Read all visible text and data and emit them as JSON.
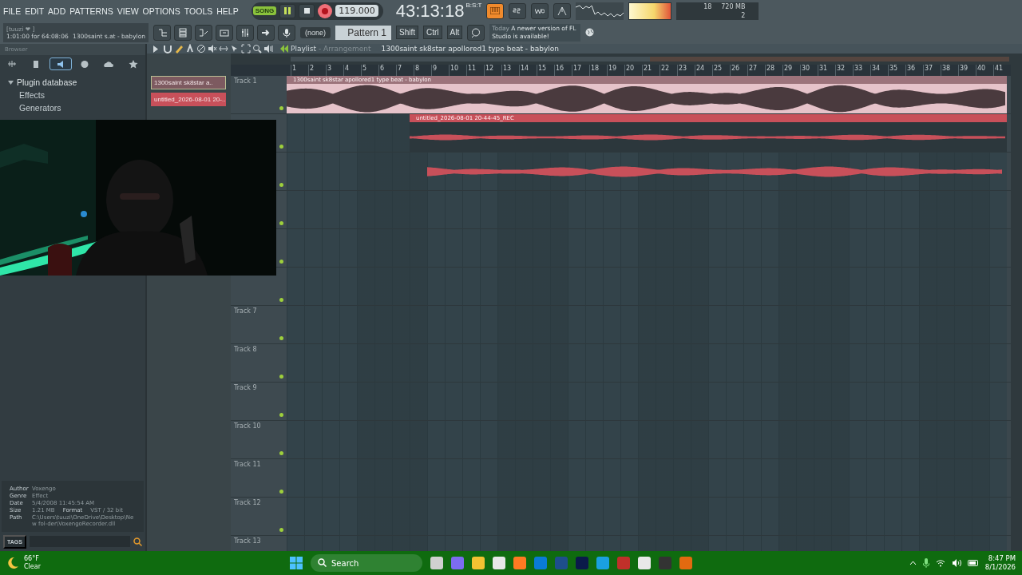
{
  "menu": [
    "FILE",
    "EDIT",
    "ADD",
    "PATTERNS",
    "VIEW",
    "OPTIONS",
    "TOOLS",
    "HELP"
  ],
  "transport": {
    "mode": "SONG",
    "playing": true,
    "tempo": "119.000",
    "time": "43:13:18",
    "time_unit": "B:S:T"
  },
  "hint": {
    "user": "[tuuzi ❤   ]",
    "position": "1:01:00 for 64:08:06",
    "song": "1300saint  s.at - babylon"
  },
  "pattern": {
    "snap": "(none)",
    "name": "Pattern 1"
  },
  "modifier_keys": [
    "Shift",
    "Ctrl",
    "Alt"
  ],
  "news": {
    "date": "Today",
    "message": "A newer version of FL Studio is available!"
  },
  "monitor": {
    "cpu": "18",
    "memory": "720 MB",
    "polyphony": "2"
  },
  "browser": {
    "title": "Browser",
    "tabs": [
      {
        "selected": false
      },
      {
        "selected": false
      },
      {
        "selected": true
      },
      {
        "selected": false
      },
      {
        "selected": false
      },
      {
        "selected": false
      }
    ],
    "tree": [
      {
        "label": "Plugin database",
        "expanded": true,
        "children": [
          {
            "label": "Effects"
          },
          {
            "label": "Generators"
          }
        ]
      }
    ],
    "details": [
      {
        "label": "Author",
        "value": "Voxengo"
      },
      {
        "label": "Genre",
        "value": "Effect"
      },
      {
        "label": "Date",
        "value": "5/4/2008 11:45:54 AM"
      },
      {
        "label": "Size",
        "value": "1.21 MB",
        "extra_label": "Format",
        "extra_value": "VST / 32 bit"
      },
      {
        "label": "Path",
        "value": "C:\\Users\\tuuzi\\OneDrive\\Desktop\\New fol-der\\VoxengoRecorder.dll"
      }
    ],
    "tags_label": "TAGS"
  },
  "channels": [
    {
      "name": "1300saint  sk8star  a..",
      "selected": true,
      "color": "#7d5a60"
    },
    {
      "name": "untitled_2026-08-01 20-..",
      "selected": false,
      "color": "#c8505a"
    }
  ],
  "playlist": {
    "title": "Playlist",
    "subtitle": "- Arrangement",
    "song": "1300saint  sk8star  apollored1 type beat - babylon",
    "bars": [
      "1",
      "2",
      "3",
      "4",
      "5",
      "6",
      "7",
      "8",
      "9",
      "10",
      "11",
      "12",
      "13",
      "14",
      "15",
      "16",
      "17",
      "18",
      "19",
      "20",
      "21",
      "22",
      "23",
      "24",
      "25",
      "26",
      "27",
      "28",
      "29",
      "30",
      "31",
      "32",
      "33",
      "34",
      "35",
      "36",
      "37",
      "38",
      "39",
      "40",
      "41"
    ],
    "tracks": [
      {
        "name": "Track 1",
        "enabled": true,
        "clips": [
          {
            "kind": "audio",
            "label": "1300saint  sk8star  apollored1 type beat - babylon",
            "color": "#e6c3ca"
          }
        ]
      },
      {
        "enabled": true,
        "clips": [
          {
            "kind": "recording",
            "label": "untitled_2026-08-01 20-44-45_REC",
            "color": "#c8505a"
          }
        ]
      },
      {
        "enabled": true,
        "clips": [
          {
            "kind": "waveform",
            "color": "#c8505a"
          }
        ]
      },
      {
        "enabled": true
      },
      {
        "enabled": true
      },
      {
        "enabled": true
      },
      {
        "name": "Track 7",
        "enabled": true
      },
      {
        "name": "Track 8",
        "enabled": true
      },
      {
        "name": "Track 9",
        "enabled": true
      },
      {
        "name": "Track 10",
        "enabled": true
      },
      {
        "name": "Track 11",
        "enabled": true
      },
      {
        "name": "Track 12",
        "enabled": true
      },
      {
        "name": "Track 13"
      }
    ]
  },
  "taskbar": {
    "weather": {
      "temperature": "66°F",
      "condition": "Clear"
    },
    "search": {
      "placeholder": "Search"
    },
    "time": "8:47 PM",
    "date": "8/1/2026"
  }
}
